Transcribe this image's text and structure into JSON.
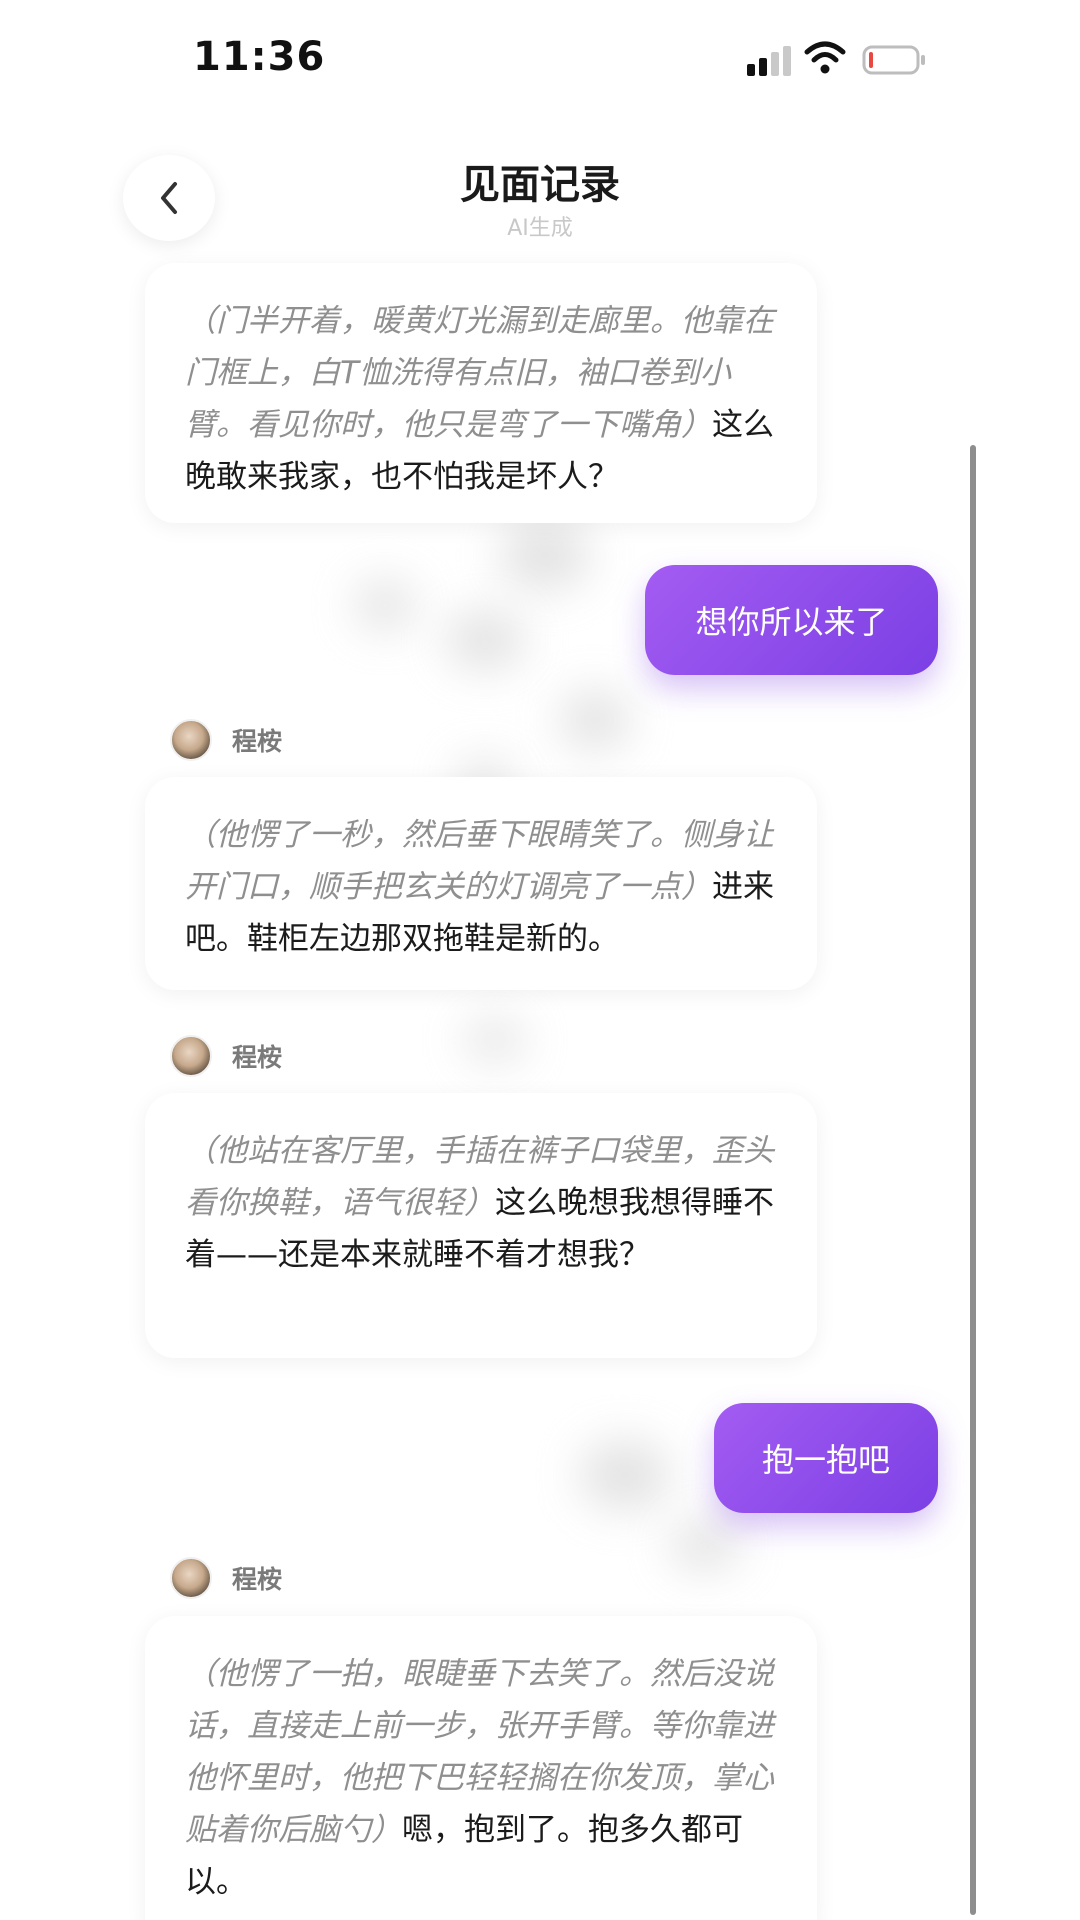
{
  "status_bar": {
    "time": "11:36"
  },
  "header": {
    "title": "见面记录",
    "subtitle": "AI生成"
  },
  "colors": {
    "user_bubble": "#8a4bea",
    "action_text": "#8f8f8f",
    "speech_text": "#1b1b1b",
    "battery_low": "#e8483f"
  },
  "messages": [
    {
      "role": "ai",
      "action": "（门半开着，暖黄灯光漏到走廊里。他靠在门框上，白T恤洗得有点旧，袖口卷到小臂。看见你时，他只是弯了一下嘴角）",
      "speech": "这么晚敢来我家，也不怕我是坏人？"
    },
    {
      "role": "user",
      "text": "想你所以来了"
    },
    {
      "role": "ai",
      "sender": "程桉",
      "action": "（他愣了一秒，然后垂下眼睛笑了。侧身让开门口，顺手把玄关的灯调亮了一点）",
      "speech": "进来吧。鞋柜左边那双拖鞋是新的。"
    },
    {
      "role": "ai",
      "sender": "程桉",
      "action": "（他站在客厅里，手插在裤子口袋里，歪头看你换鞋，语气很轻）",
      "speech": "这么晚想我想得睡不着——还是本来就睡不着才想我？"
    },
    {
      "role": "user",
      "text": "抱一抱吧"
    },
    {
      "role": "ai",
      "sender": "程桉",
      "action": "（他愣了一拍，眼睫垂下去笑了。然后没说话，直接走上前一步，张开手臂。等你靠进他怀里时，他把下巴轻轻搁在你发顶，掌心贴着你后脑勺）",
      "speech": "嗯，抱到了。抱多久都可以。"
    }
  ]
}
